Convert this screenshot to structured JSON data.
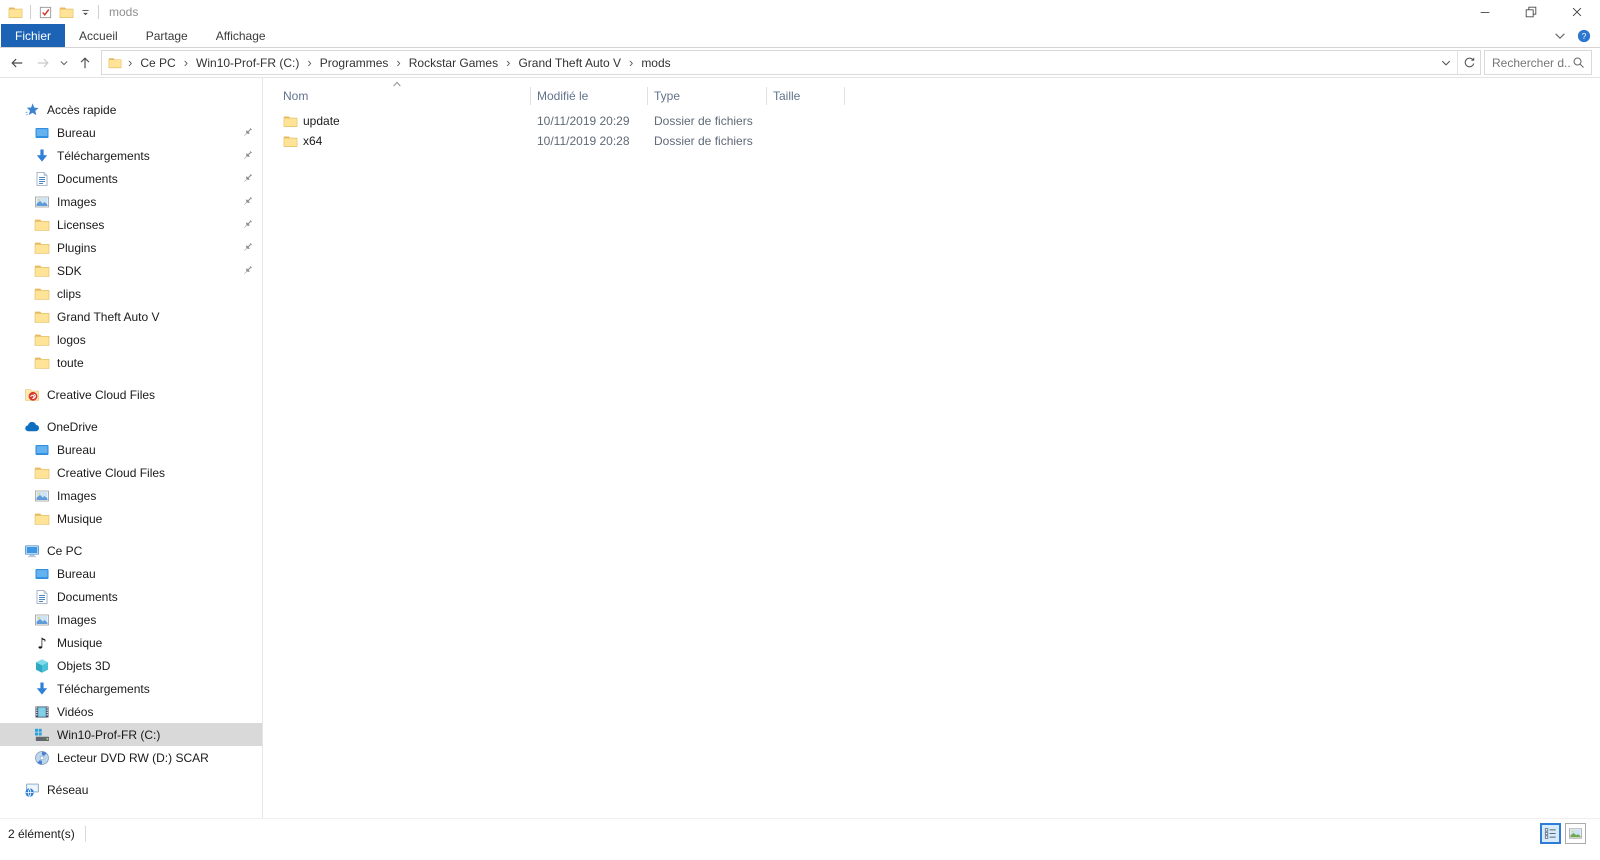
{
  "colors": {
    "accent_blue": "#1d63b5",
    "selection_gray": "#d9d9d9",
    "folder_yellow": "#ffe396"
  },
  "titlebar": {
    "title": "mods"
  },
  "ribbon": {
    "tabs": [
      {
        "label": "Fichier",
        "active": true
      },
      {
        "label": "Accueil",
        "active": false
      },
      {
        "label": "Partage",
        "active": false
      },
      {
        "label": "Affichage",
        "active": false
      }
    ]
  },
  "address": {
    "crumbs": [
      "Ce PC",
      "Win10-Prof-FR (C:)",
      "Programmes",
      "Rockstar Games",
      "Grand Theft Auto V",
      "mods"
    ],
    "search_placeholder": "Rechercher d..."
  },
  "list": {
    "columns": [
      {
        "label": "Nom",
        "sorted": true
      },
      {
        "label": "Modifié le",
        "sorted": false
      },
      {
        "label": "Type",
        "sorted": false
      },
      {
        "label": "Taille",
        "sorted": false
      }
    ],
    "rows": [
      {
        "icon": "folder",
        "name": "update",
        "modified": "10/11/2019 20:29",
        "type": "Dossier de fichiers",
        "size": ""
      },
      {
        "icon": "folder",
        "name": "x64",
        "modified": "10/11/2019 20:28",
        "type": "Dossier de fichiers",
        "size": ""
      }
    ]
  },
  "sidebar": {
    "items": [
      {
        "label": "Accès rapide",
        "icon": "quick-access-star",
        "depth": 0
      },
      {
        "label": "Bureau",
        "icon": "desktop",
        "depth": 1,
        "pinned": true
      },
      {
        "label": "Téléchargements",
        "icon": "download",
        "depth": 1,
        "pinned": true
      },
      {
        "label": "Documents",
        "icon": "document",
        "depth": 1,
        "pinned": true
      },
      {
        "label": "Images",
        "icon": "picture",
        "depth": 1,
        "pinned": true
      },
      {
        "label": "Licenses",
        "icon": "folder",
        "depth": 1,
        "pinned": true
      },
      {
        "label": "Plugins",
        "icon": "folder",
        "depth": 1,
        "pinned": true
      },
      {
        "label": "SDK",
        "icon": "folder",
        "depth": 1,
        "pinned": true
      },
      {
        "label": "clips",
        "icon": "folder",
        "depth": 1
      },
      {
        "label": "Grand Theft Auto V",
        "icon": "folder",
        "depth": 1
      },
      {
        "label": "logos",
        "icon": "folder",
        "depth": 1
      },
      {
        "label": "toute",
        "icon": "folder",
        "depth": 1
      },
      {
        "label": "Creative Cloud Files",
        "icon": "creative-cloud",
        "depth": 0,
        "gap": true
      },
      {
        "label": "OneDrive",
        "icon": "onedrive-cloud",
        "depth": 0,
        "gap": true
      },
      {
        "label": "Bureau",
        "icon": "desktop",
        "depth": 1
      },
      {
        "label": "Creative Cloud Files",
        "icon": "folder",
        "depth": 1
      },
      {
        "label": "Images",
        "icon": "picture",
        "depth": 1
      },
      {
        "label": "Musique",
        "icon": "folder",
        "depth": 1
      },
      {
        "label": "Ce PC",
        "icon": "computer",
        "depth": 0,
        "gap": true
      },
      {
        "label": "Bureau",
        "icon": "desktop",
        "depth": 1
      },
      {
        "label": "Documents",
        "icon": "document",
        "depth": 1
      },
      {
        "label": "Images",
        "icon": "picture",
        "depth": 1
      },
      {
        "label": "Musique",
        "icon": "music-note",
        "depth": 1
      },
      {
        "label": "Objets 3D",
        "icon": "cube-3d",
        "depth": 1
      },
      {
        "label": "Téléchargements",
        "icon": "download",
        "depth": 1
      },
      {
        "label": "Vidéos",
        "icon": "video",
        "depth": 1
      },
      {
        "label": "Win10-Prof-FR (C:)",
        "icon": "windows-drive",
        "depth": 1,
        "selected": true
      },
      {
        "label": "Lecteur DVD RW (D:) SCAR",
        "icon": "dvd-drive",
        "depth": 1
      },
      {
        "label": "Réseau",
        "icon": "network",
        "depth": 0,
        "gap": true
      }
    ]
  },
  "statusbar": {
    "count": "2 élément(s)"
  }
}
